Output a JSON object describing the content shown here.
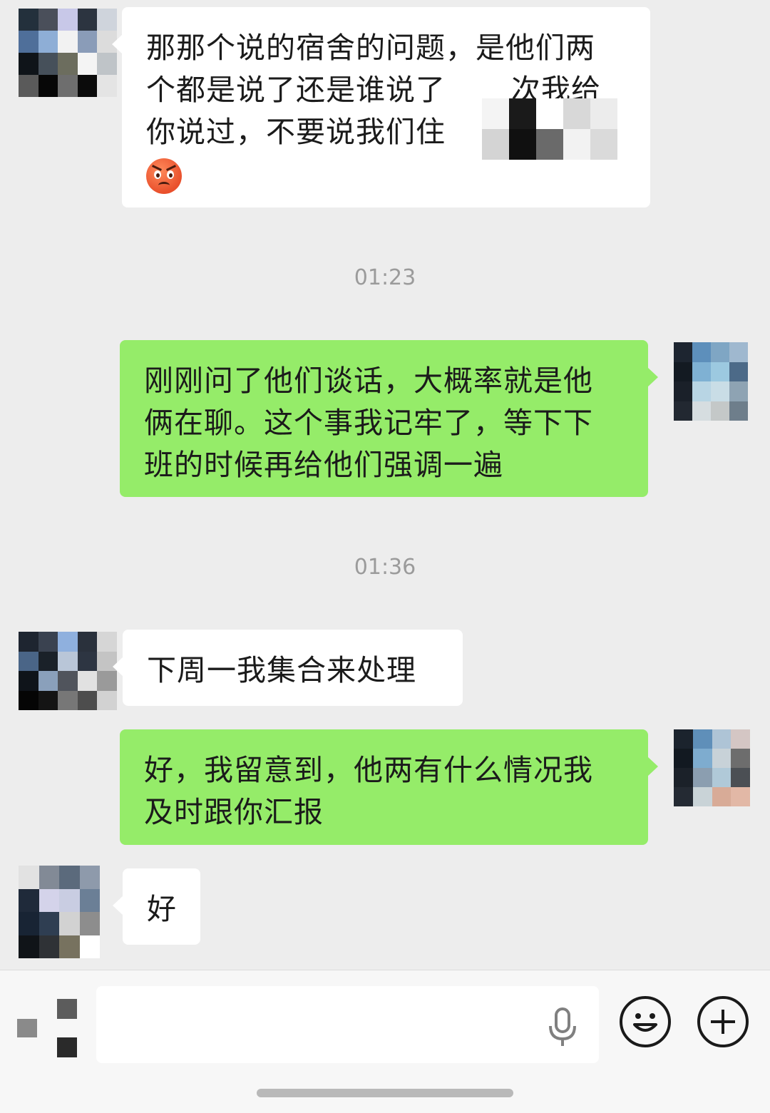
{
  "messages": [
    {
      "direction": "incoming",
      "lines": [
        "那那个说的宿舍的问题，是他们两",
        "个都是说了还是谁说了",
        "次我给",
        "你说过，不要说我们住"
      ],
      "emoji": "angry-face"
    },
    {
      "timestamp": "01:23"
    },
    {
      "direction": "outgoing",
      "lines": [
        "刚刚问了他们谈话，大概率就是他",
        "俩在聊。这个事我记牢了，等下下",
        "班的时候再给他们强调一遍"
      ]
    },
    {
      "timestamp": "01:36"
    },
    {
      "direction": "incoming",
      "lines": [
        "下周一我集合来处理"
      ]
    },
    {
      "direction": "outgoing",
      "lines": [
        "好，我留意到，他两有什么情况我",
        "及时跟你汇报"
      ]
    },
    {
      "direction": "incoming",
      "lines": [
        "好"
      ]
    }
  ],
  "input_bar": {
    "placeholder": "",
    "icons": [
      "voice-toggle-icon",
      "mic-icon",
      "emoji-icon",
      "plus-icon"
    ]
  },
  "colors": {
    "background": "#ededed",
    "incoming_bubble": "#ffffff",
    "outgoing_bubble": "#95ec69",
    "timestamp_text": "#9b9b9b"
  }
}
